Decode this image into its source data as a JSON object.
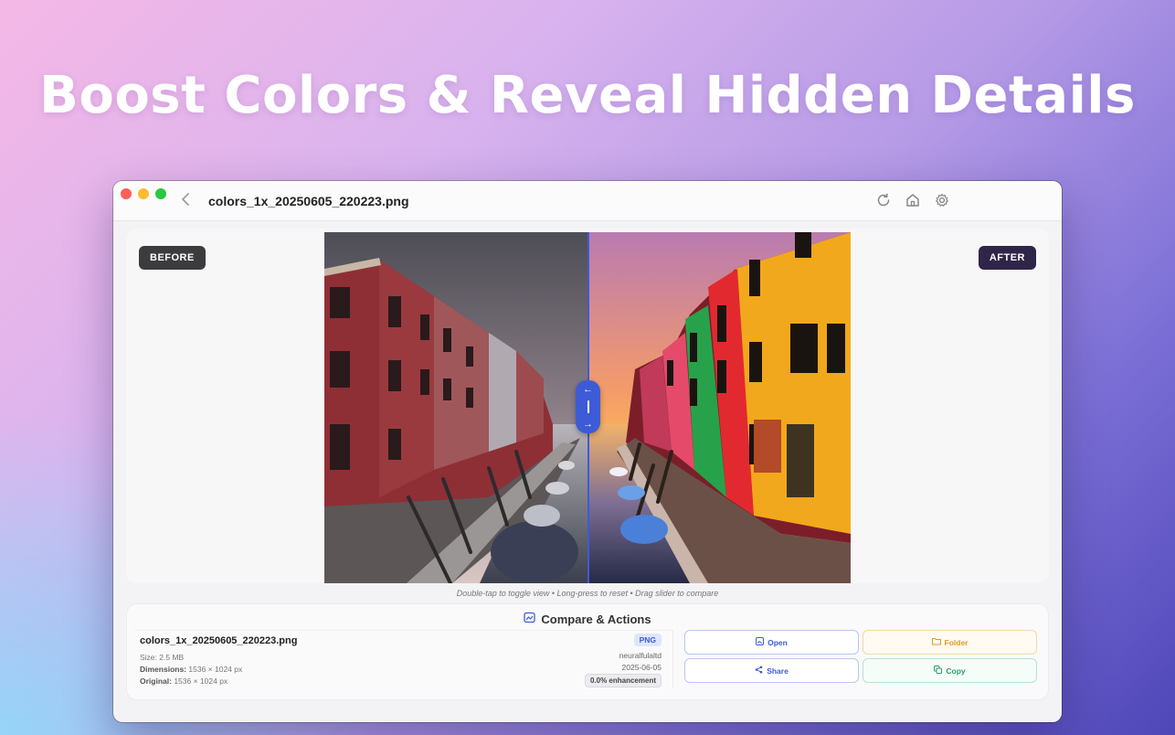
{
  "headline": "Boost Colors & Reveal Hidden Details",
  "titlebar": {
    "back_icon": "chevron-left-icon",
    "filename": "colors_1x_20250605_220223.png",
    "icons": [
      "refresh-icon",
      "home-icon",
      "gear-icon"
    ]
  },
  "compare": {
    "before_label": "BEFORE",
    "after_label": "AFTER",
    "slider_position": 0.5,
    "hint": "Double-tap to toggle view • Long-press to reset • Drag slider to compare"
  },
  "panel": {
    "title": "Compare & Actions",
    "title_icon": "compare-icon",
    "file": {
      "name": "colors_1x_20250605_220223.png",
      "size_label": "Size:",
      "size_value": "2.5 MB",
      "dimensions_label": "Dimensions:",
      "dimensions_value": "1536 × 1024 px",
      "original_label": "Original:",
      "original_value": "1536 × 1024 px",
      "format": "PNG",
      "author": "neuralfulaltd",
      "date": "2025-06-05",
      "enhancement": "0.0% enhancement"
    },
    "buttons": {
      "open": "Open",
      "folder": "Folder",
      "share": "Share",
      "copy": "Copy"
    }
  },
  "colors": {
    "accent": "#3d5bd6",
    "folder": "#e39a22",
    "copy": "#2a9b6a"
  }
}
